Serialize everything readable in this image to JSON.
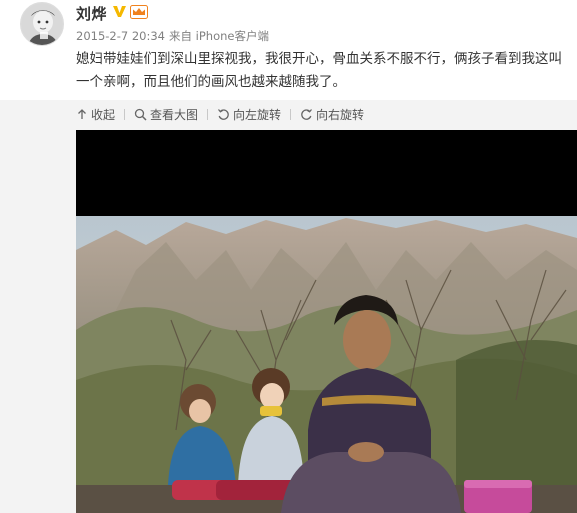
{
  "post": {
    "username": "刘烨",
    "timestamp": "2015-2-7 20:34",
    "source": "来自 iPhone客户端",
    "text": "媳妇带娃娃们到深山里探视我，我很开心，骨血关系不服不行，俩孩子看到我这叫一个亲啊，而且他们的画风也越来越随我了。",
    "verified_icon": "verified-v-icon",
    "vip_icon": "vip-crown-icon"
  },
  "toolbar": {
    "collapse_label": "收起",
    "view_large_label": "查看大图",
    "rotate_left_label": "向左旋转",
    "rotate_right_label": "向右旋转"
  },
  "colors": {
    "verified_badge": "#f5b800",
    "vip_badge": "#f0821e",
    "toolbar_bg": "#f3f3f3",
    "text": "#333333",
    "meta": "#808080"
  }
}
